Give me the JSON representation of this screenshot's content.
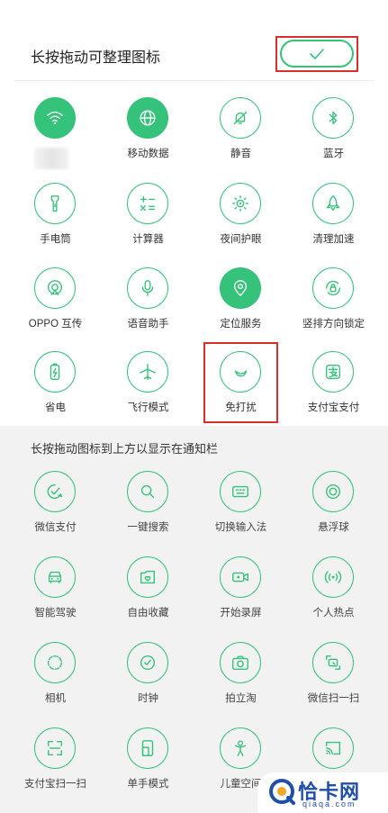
{
  "header": {
    "title": "长按拖动可整理图标",
    "done_icon": "check-icon"
  },
  "active_tiles": [
    {
      "label": "",
      "icon": "wifi-icon",
      "on": true
    },
    {
      "label": "移动数据",
      "icon": "globe-icon",
      "on": true
    },
    {
      "label": "静音",
      "icon": "bell-mute-icon",
      "on": false
    },
    {
      "label": "蓝牙",
      "icon": "bluetooth-icon",
      "on": false
    },
    {
      "label": "手电筒",
      "icon": "flashlight-icon",
      "on": false
    },
    {
      "label": "计算器",
      "icon": "calculator-icon",
      "on": false
    },
    {
      "label": "夜间护眼",
      "icon": "eye-protect-icon",
      "on": false
    },
    {
      "label": "清理加速",
      "icon": "rocket-icon",
      "on": false
    },
    {
      "label": "OPPO 互传",
      "icon": "share-icon",
      "on": false
    },
    {
      "label": "语音助手",
      "icon": "microphone-icon",
      "on": false
    },
    {
      "label": "定位服务",
      "icon": "location-icon",
      "on": true
    },
    {
      "label": "竖排方向锁定",
      "icon": "rotation-lock-icon",
      "on": false
    },
    {
      "label": "省电",
      "icon": "battery-icon",
      "on": false
    },
    {
      "label": "飞行模式",
      "icon": "airplane-icon",
      "on": false
    },
    {
      "label": "免打扰",
      "icon": "moon-icon",
      "on": false
    },
    {
      "label": "支付宝支付",
      "icon": "alipay-icon",
      "on": false
    }
  ],
  "inactive_section": {
    "title": "长按拖动图标到上方以显示在通知栏",
    "tiles": [
      {
        "label": "微信支付",
        "icon": "wechat-pay-icon"
      },
      {
        "label": "一键搜索",
        "icon": "search-icon"
      },
      {
        "label": "切换输入法",
        "icon": "keyboard-icon"
      },
      {
        "label": "悬浮球",
        "icon": "floating-ball-icon"
      },
      {
        "label": "智能驾驶",
        "icon": "car-icon"
      },
      {
        "label": "自由收藏",
        "icon": "favorites-icon"
      },
      {
        "label": "开始录屏",
        "icon": "screen-record-icon"
      },
      {
        "label": "个人热点",
        "icon": "hotspot-icon"
      },
      {
        "label": "相机",
        "icon": "camera-ring-icon"
      },
      {
        "label": "时钟",
        "icon": "clock-icon"
      },
      {
        "label": "拍立淘",
        "icon": "photo-camera-icon"
      },
      {
        "label": "微信扫一扫",
        "icon": "wechat-scan-icon"
      },
      {
        "label": "支付宝扫一扫",
        "icon": "alipay-scan-icon"
      },
      {
        "label": "单手模式",
        "icon": "one-hand-icon"
      },
      {
        "label": "儿童空间",
        "icon": "kids-space-icon"
      },
      {
        "label": "",
        "icon": "cast-screen-icon"
      }
    ]
  },
  "watermark": {
    "text": "恰卡网",
    "url": "qiaqa.com",
    "logo_icon": "watermark-logo-icon"
  },
  "colors": {
    "accent": "#35c27a",
    "highlight_box": "#d9302c",
    "lower_bg": "#f2f2f2",
    "watermark": "#1f4fa8"
  }
}
